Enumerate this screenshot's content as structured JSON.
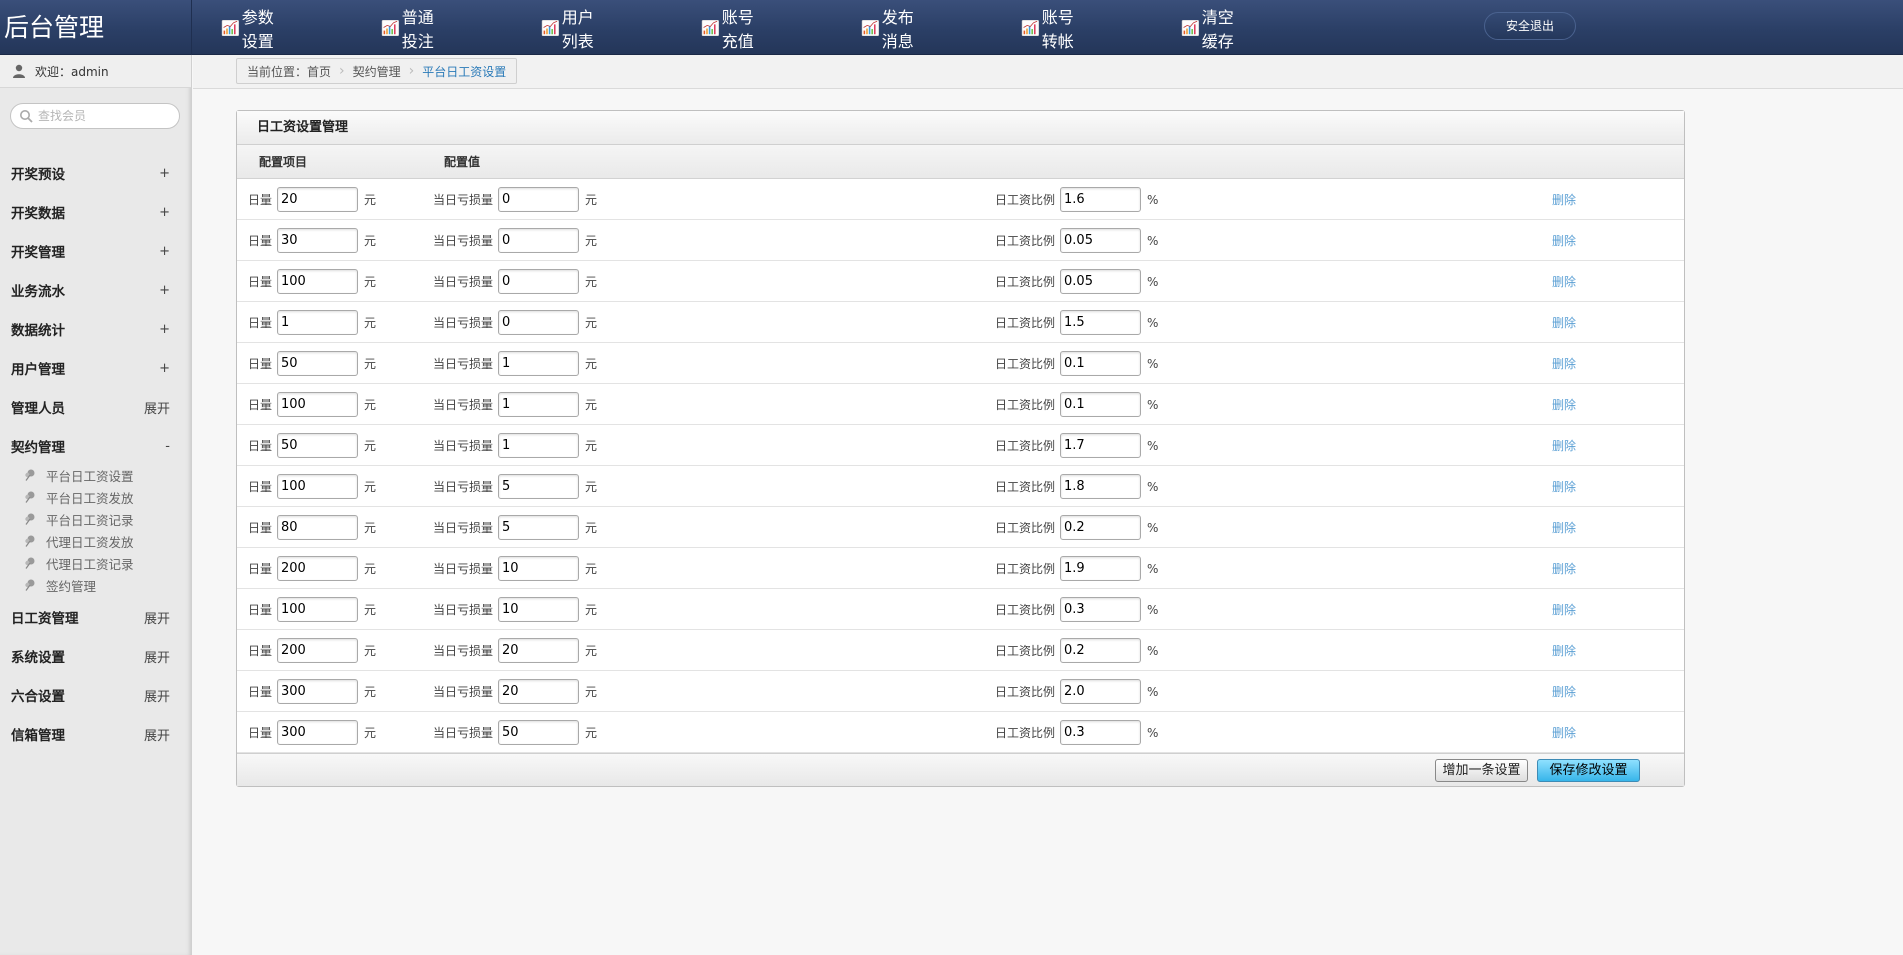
{
  "header": {
    "title": "后台管理",
    "nav": [
      {
        "label": "参数设置"
      },
      {
        "label": "普通投注"
      },
      {
        "label": "用户列表"
      },
      {
        "label": "账号充值"
      },
      {
        "label": "发布消息"
      },
      {
        "label": "账号转帐"
      },
      {
        "label": "清空缓存"
      }
    ],
    "logout": "安全退出"
  },
  "sidebar": {
    "welcome": "欢迎：admin",
    "search_placeholder": "查找会员",
    "menu": [
      {
        "label": "开奖预设",
        "toggle": "+"
      },
      {
        "label": "开奖数据",
        "toggle": "+"
      },
      {
        "label": "开奖管理",
        "toggle": "+"
      },
      {
        "label": "业务流水",
        "toggle": "+"
      },
      {
        "label": "数据统计",
        "toggle": "+"
      },
      {
        "label": "用户管理",
        "toggle": "+"
      },
      {
        "label": "管理人员",
        "toggle": "展开"
      },
      {
        "label": "契约管理",
        "toggle": "-"
      },
      {
        "label": "日工资管理",
        "toggle": "展开"
      },
      {
        "label": "系统设置",
        "toggle": "展开"
      },
      {
        "label": "六合设置",
        "toggle": "展开"
      },
      {
        "label": "信箱管理",
        "toggle": "展开"
      }
    ],
    "submenu": [
      {
        "label": "平台日工资设置"
      },
      {
        "label": "平台日工资发放"
      },
      {
        "label": "平台日工资记录"
      },
      {
        "label": "代理日工资发放"
      },
      {
        "label": "代理日工资记录"
      },
      {
        "label": "签约管理"
      }
    ]
  },
  "breadcrumb": {
    "prefix": "当前位置：首页",
    "parent": "契约管理",
    "current": "平台日工资设置"
  },
  "panel": {
    "title": "日工资设置管理",
    "col_item": "配置项目",
    "col_value": "配置值",
    "label_volume": "日量",
    "label_loss": "当日亏损量",
    "label_ratio": "日工资比例",
    "unit_yuan": "元",
    "unit_pct": "%",
    "delete_label": "删除",
    "rows": [
      {
        "volume": "20",
        "loss": "0",
        "ratio": "1.6"
      },
      {
        "volume": "30",
        "loss": "0",
        "ratio": "0.05"
      },
      {
        "volume": "100",
        "loss": "0",
        "ratio": "0.05"
      },
      {
        "volume": "1",
        "loss": "0",
        "ratio": "1.5"
      },
      {
        "volume": "50",
        "loss": "1",
        "ratio": "0.1"
      },
      {
        "volume": "100",
        "loss": "1",
        "ratio": "0.1"
      },
      {
        "volume": "50",
        "loss": "1",
        "ratio": "1.7"
      },
      {
        "volume": "100",
        "loss": "5",
        "ratio": "1.8"
      },
      {
        "volume": "80",
        "loss": "5",
        "ratio": "0.2"
      },
      {
        "volume": "200",
        "loss": "10",
        "ratio": "1.9"
      },
      {
        "volume": "100",
        "loss": "10",
        "ratio": "0.3"
      },
      {
        "volume": "200",
        "loss": "20",
        "ratio": "0.2"
      },
      {
        "volume": "300",
        "loss": "20",
        "ratio": "2.0"
      },
      {
        "volume": "300",
        "loss": "50",
        "ratio": "0.3"
      }
    ],
    "add_button": "增加一条设置",
    "save_button": "保存修改设置"
  }
}
